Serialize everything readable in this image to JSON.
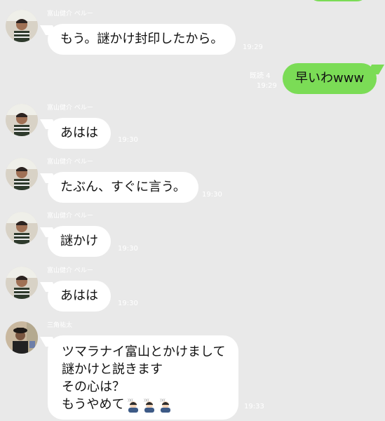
{
  "messages": [
    {
      "sender": "富山健介 ペルー",
      "text": "もう。謎かけ封印したから。",
      "time": "19:29",
      "avatar": "avatar-photo-icon"
    },
    {
      "text": "早いわwww",
      "time": "19:29",
      "read": "既読 4"
    },
    {
      "sender": "富山健介 ペルー",
      "text": "あはは",
      "time": "19:30",
      "avatar": "avatar-photo-icon"
    },
    {
      "sender": "富山健介 ペルー",
      "text": "たぶん、すぐに言う。",
      "time": "19:30",
      "avatar": "avatar-photo-icon"
    },
    {
      "sender": "富山健介 ペルー",
      "text": "謎かけ",
      "time": "19:30",
      "avatar": "avatar-photo-icon"
    },
    {
      "sender": "富山健介 ペルー",
      "text": "あはは",
      "time": "19:30",
      "avatar": "avatar-photo-icon"
    },
    {
      "sender": "三角祐太",
      "lines": [
        "ツマラナイ富山とかけまして",
        "謎かけと説きます",
        "その心は？",
        "もうやめて"
      ],
      "emoji": [
        "bowing-person-icon",
        "bowing-person-icon",
        "bowing-person-icon"
      ],
      "time": "19:33",
      "avatar": "avatar-photo-icon"
    }
  ],
  "colors": {
    "background": "#e9e9e9",
    "incoming_bubble": "#ffffff",
    "outgoing_bubble": "#7bdc56",
    "meta_text": "#ffffff"
  }
}
